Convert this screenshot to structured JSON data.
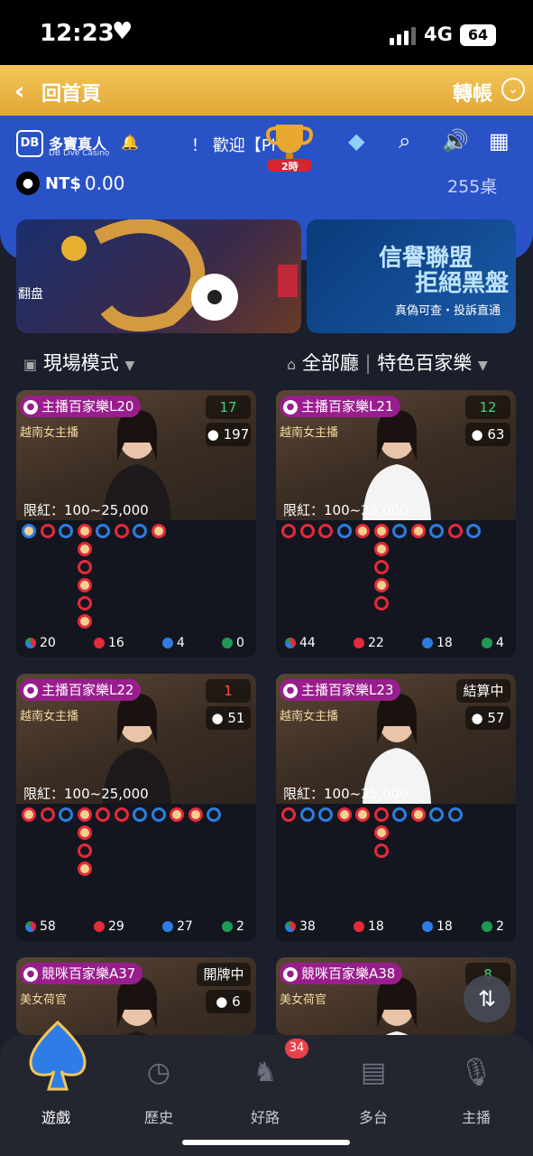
{
  "status_bar": {
    "time": "12:23",
    "network": "4G",
    "battery": "64"
  },
  "topbar": {
    "back_label": "回首頁",
    "transfer_label": "轉帳"
  },
  "header": {
    "brand": "多寶真人",
    "brand_sub": "DB Live Casino",
    "marquee": "！ 歡迎【Pl",
    "trophy_label": "2時",
    "currency": "NT$",
    "balance": "0.00",
    "table_count": "255桌"
  },
  "banners": [
    {
      "text": "翻盘"
    },
    {
      "line1": "信譽聯盟",
      "line2": "拒絕黑盤",
      "line3": "真偽可查・投訴直通"
    }
  ],
  "filters": {
    "mode": "現場模式",
    "hall": "全部廳",
    "category": "特色百家樂"
  },
  "tables": [
    {
      "name": "主播百家樂L20",
      "timer": "17",
      "players": "197",
      "badge": "越南女主播",
      "limit": "限紅：100~25,000",
      "stats": {
        "total": "20",
        "banker": "16",
        "player": "4",
        "tie": "0"
      }
    },
    {
      "name": "主播百家樂L21",
      "timer": "12",
      "players": "63",
      "badge": "越南女主播",
      "limit": "限紅：100~25,000",
      "stats": {
        "total": "44",
        "banker": "22",
        "player": "18",
        "tie": "4"
      }
    },
    {
      "name": "主播百家樂L22",
      "timer": "1",
      "players": "51",
      "badge": "越南女主播",
      "limit": "限紅：100~25,000",
      "stats": {
        "total": "58",
        "banker": "29",
        "player": "27",
        "tie": "2"
      }
    },
    {
      "name": "主播百家樂L23",
      "timer": "結算中",
      "players": "57",
      "badge": "越南女主播",
      "limit": "限紅：100~25,000",
      "stats": {
        "total": "38",
        "banker": "18",
        "player": "18",
        "tie": "2"
      }
    },
    {
      "name": "競咪百家樂A37",
      "timer": "開牌中",
      "players": "6",
      "badge": "美女荷官"
    },
    {
      "name": "競咪百家樂A38",
      "timer": "8",
      "badge": "美女荷官"
    }
  ],
  "nav": [
    {
      "label": "遊戲"
    },
    {
      "label": "歷史"
    },
    {
      "label": "好路",
      "badge": "34"
    },
    {
      "label": "多台"
    },
    {
      "label": "主播"
    }
  ],
  "colors": {
    "accent": "#e9b23f",
    "header_blue": "#2a52c7",
    "banker": "#e52a3a",
    "player": "#2d7de0",
    "tie": "#1f9a55"
  }
}
